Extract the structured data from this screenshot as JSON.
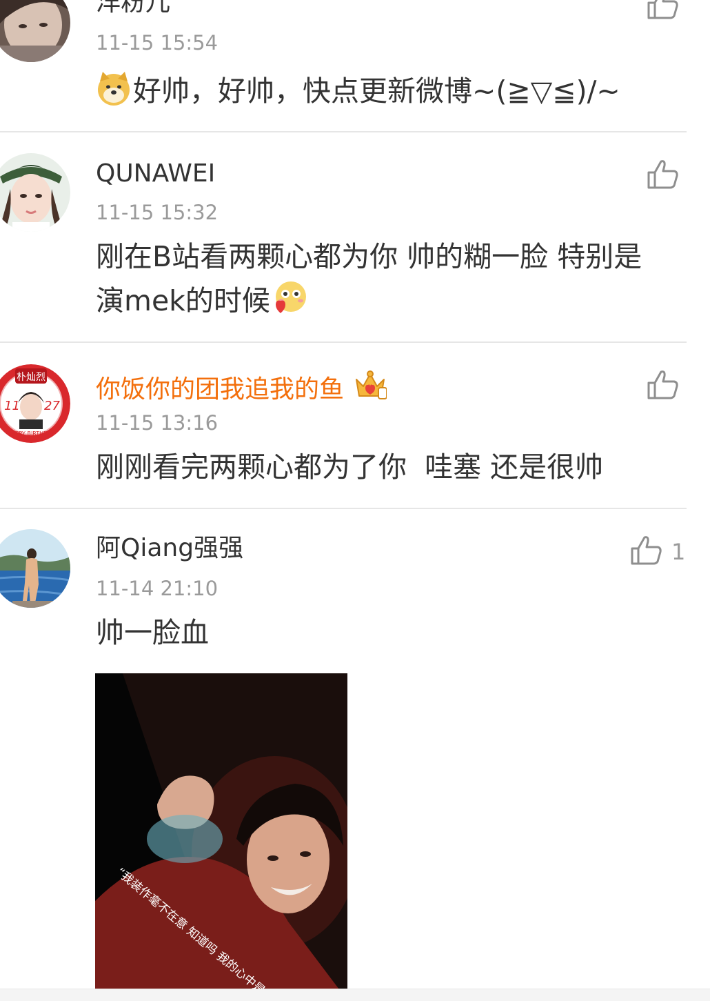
{
  "comments": [
    {
      "name": "洋粉儿",
      "time": "11-15 15:54",
      "text": "好帅，好帅，快点更新微博~(≧▽≦)/~",
      "emoji": "doge-emoji",
      "likes": ""
    },
    {
      "name": "QUNAWEI",
      "time": "11-15 15:32",
      "text": "刚在B站看两颗心都为你 帅的糊一脸 特别是演mek的时候",
      "emoji": "love-blush-emoji",
      "likes": ""
    },
    {
      "name": "你饭你的团我追我的鱼",
      "time": "11-15 13:16",
      "text": "刚刚看完两颗心都为了你  哇塞 还是很帅",
      "badge": "vip-crown-icon",
      "likes": ""
    },
    {
      "name": "阿Qiang强强",
      "time": "11-14 21:10",
      "text": "帅一脸血",
      "likes": "1",
      "image_caption": "“我装作毫不在意 知道吗 我的心中是多么"
    }
  ],
  "avatar_badge": {
    "name": "朴灿烈",
    "left": "11",
    "right": "27",
    "bottom": "HAPPY BIRTHDAY"
  },
  "colors": {
    "vip_name": "#f36f0c",
    "text": "#333333",
    "meta": "#9a9a9a",
    "divider": "#e6e6e6"
  }
}
